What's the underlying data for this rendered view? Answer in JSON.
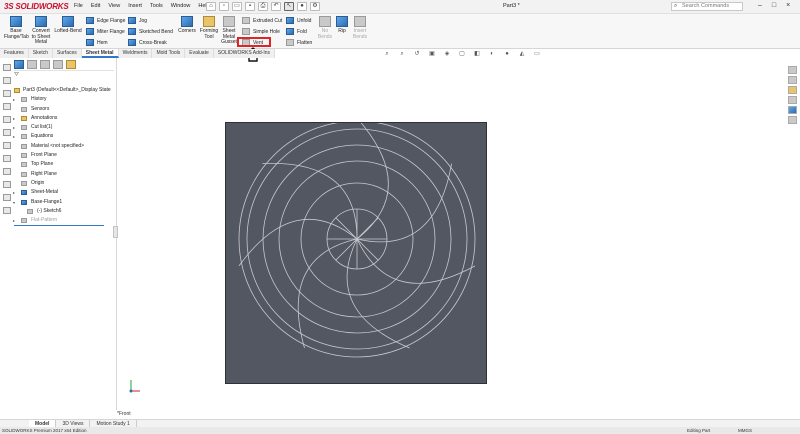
{
  "app": {
    "brand": "SOLIDWORKS",
    "document_title": "Part3 *"
  },
  "menu": [
    "File",
    "Edit",
    "View",
    "Insert",
    "Tools",
    "Window",
    "Help"
  ],
  "search": {
    "placeholder": "Search Commands"
  },
  "ribbon": {
    "base_flange": "Base Flange/Tab",
    "convert": "Convert to Sheet Metal",
    "lofted_bend": "Lofted-Bend",
    "edge_flange": "Edge Flange",
    "miter_flange": "Miter Flange",
    "hem": "Hem",
    "jog": "Jog",
    "sketched_bend": "Sketched Bend",
    "cross_break": "Cross-Break",
    "corners": "Corners",
    "forming_tool": "Forming Tool",
    "sheet_metal_gusset": "Sheet Metal Gusset",
    "extruded_cut": "Extruded Cut",
    "simple_hole": "Simple Hole",
    "vent": "Vent",
    "unfold": "Unfold",
    "fold": "Fold",
    "flatten": "Flatten",
    "no_bends": "No Bends",
    "rip": "Rip",
    "insert_bends": "Insert Bends"
  },
  "tabs": [
    "Features",
    "Sketch",
    "Surfaces",
    "Sheet Metal",
    "Weldments",
    "Mold Tools",
    "Evaluate",
    "SOLIDWORKS Add-Ins"
  ],
  "active_tab": "Sheet Metal",
  "tree": {
    "root": "Part3 (Default<<Default>_Display State",
    "items": [
      {
        "label": "History",
        "expander": "▸"
      },
      {
        "label": "Sensors",
        "expander": ""
      },
      {
        "label": "Annotations",
        "expander": "▸"
      },
      {
        "label": "Cut list(1)",
        "expander": "▸"
      },
      {
        "label": "Equations",
        "expander": "▸"
      },
      {
        "label": "Material <not specified>",
        "expander": ""
      },
      {
        "label": "Front Plane",
        "expander": ""
      },
      {
        "label": "Top Plane",
        "expander": ""
      },
      {
        "label": "Right Plane",
        "expander": ""
      },
      {
        "label": "Origin",
        "expander": ""
      },
      {
        "label": "Sheet-Metal",
        "expander": "▸"
      },
      {
        "label": "Base-Flange1",
        "expander": "▾"
      },
      {
        "label": "(-) Sketch6",
        "expander": ""
      },
      {
        "label": "Flat-Pattern",
        "expander": "▸"
      }
    ]
  },
  "bottom_tabs": [
    "Model",
    "3D Views",
    "Motion Study 1"
  ],
  "view_label": "*Front",
  "status": {
    "edition": "SOLIDWORKS Premium 2017 x64 Edition",
    "mode": "Editing Part",
    "units": "MMGS"
  },
  "colors": {
    "sheet": "#535762",
    "sketch_lines": "#c7c9cf",
    "highlight": "#e0242a",
    "accent": "#3277c9",
    "brand": "#c8102e"
  }
}
